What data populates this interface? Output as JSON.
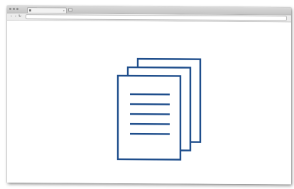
{
  "window": {
    "tab": {
      "title": "",
      "close_label": "×"
    },
    "toolbar": {
      "back_label": "‹",
      "forward_label": "›",
      "reload_label": "↻",
      "url": ""
    }
  },
  "content": {
    "illustration_icon": "documents-stack-icon",
    "accent_color": "#1f4e8c"
  }
}
